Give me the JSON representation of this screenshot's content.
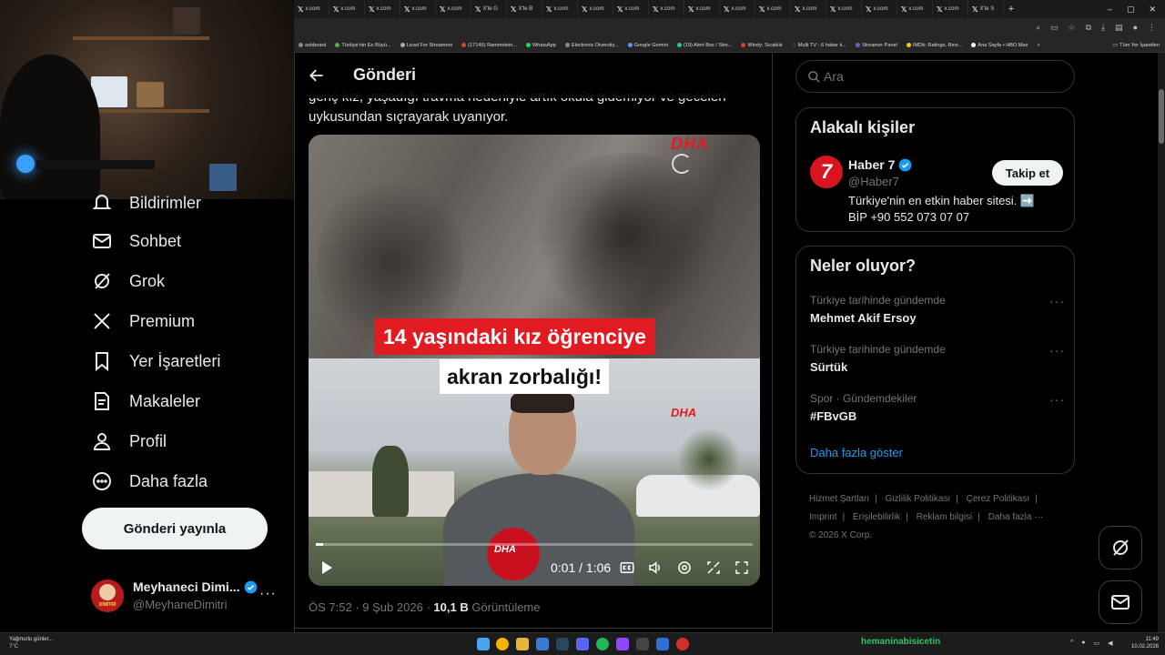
{
  "browser": {
    "tabs": [
      {
        "label": "x.com"
      },
      {
        "label": "x.com"
      },
      {
        "label": "x.com"
      },
      {
        "label": "x.com"
      },
      {
        "label": "x.com"
      },
      {
        "label": "X'te G"
      },
      {
        "label": "X'te B"
      },
      {
        "label": "x.com"
      },
      {
        "label": "x.com"
      },
      {
        "label": "x.com"
      },
      {
        "label": "x.com"
      },
      {
        "label": "x.com"
      },
      {
        "label": "x.com"
      },
      {
        "label": "x.com"
      },
      {
        "label": "x.com"
      },
      {
        "label": "x.com"
      },
      {
        "label": "x.com"
      },
      {
        "label": "x.com"
      },
      {
        "label": "x.com"
      },
      {
        "label": "X'te S"
      }
    ],
    "new_tab": "+",
    "window_controls": {
      "minimize": "–",
      "maximize": "▢",
      "close": "✕"
    },
    "bookmarks": [
      {
        "label": "ashboard",
        "color": "#888"
      },
      {
        "label": "Türkiye'nin En Büyü...",
        "color": "#4caf50"
      },
      {
        "label": "Livad For Streamers",
        "color": "#aaa"
      },
      {
        "label": "(17145) Rammstein...",
        "color": "#e53935"
      },
      {
        "label": "WhatsApp",
        "color": "#25d366"
      },
      {
        "label": "Electronic Diversity...",
        "color": "#888"
      },
      {
        "label": "Google Gemini",
        "color": "#6d8cff"
      },
      {
        "label": "(19) Alert Box / Stre...",
        "color": "#31c48d"
      },
      {
        "label": "Windy: Sıcaklık",
        "color": "#e53935"
      },
      {
        "label": "Multi TV - 6 haber k...",
        "color": "#333"
      },
      {
        "label": "Streamer Panel",
        "color": "#5c6bc0"
      },
      {
        "label": "IMDb: Ratings, Revi...",
        "color": "#f5c518"
      },
      {
        "label": "Ana Sayfa • HBO Max",
        "color": "#fff"
      }
    ],
    "bookmarks_more": "»",
    "all_bookmarks": "Tüm Yer İşaretleri"
  },
  "nav": {
    "items": [
      {
        "label": "Bildirimler"
      },
      {
        "label": "Sohbet"
      },
      {
        "label": "Grok"
      },
      {
        "label": "Premium"
      },
      {
        "label": "Yer İşaretleri"
      },
      {
        "label": "Makaleler"
      },
      {
        "label": "Profil"
      },
      {
        "label": "Daha fazla"
      }
    ],
    "post_button": "Gönderi yayınla",
    "account": {
      "name": "Meyhaneci Dimi...",
      "handle": "@MeyhaneDimitri",
      "avatar_text": "DİMİTRİ"
    }
  },
  "main": {
    "header_title": "Gönderi",
    "tweet_text": "genç kız, yaşadığı travma nedeniyle artık okula gidemiyor ve geceleri uykusundan sıçrayarak uyanıyor.",
    "video": {
      "caption_line1": "14 yaşındaki kız öğrenciye",
      "caption_line2": "akran zorbalığı!",
      "watermark": "DHA",
      "time": "0:01 / 1:06",
      "progress": 0.016
    },
    "meta": {
      "time": "ÖS 7:52",
      "date": "9 Şub 2026",
      "views_count": "10,1 B",
      "views_label": "Görüntüleme",
      "sep": "·"
    }
  },
  "right": {
    "search_placeholder": "Ara",
    "related": {
      "title": "Alakalı kişiler",
      "name": "Haber 7",
      "handle": "@Haber7",
      "avatar_text": "7",
      "bio": "Türkiye'nin en etkin haber sitesi. ➡️\nBİP +90 552 073 07 07",
      "follow": "Takip et"
    },
    "trends": {
      "title": "Neler oluyor?",
      "items": [
        {
          "context": "Türkiye tarihinde gündemde",
          "name": "Mehmet Akif Ersoy"
        },
        {
          "context": "Türkiye tarihinde gündemde",
          "name": "Sürtük"
        },
        {
          "context": "Spor · Gündemdekiler",
          "name": "#FBvGB"
        }
      ],
      "more_dots": "···",
      "show_more": "Daha fazla göster"
    },
    "footer": {
      "links": [
        "Hizmet Şartları",
        "Gizlilik Politikası",
        "Çerez Politikası",
        "Imprint",
        "Erişilebilirlik",
        "Reklam bilgisi",
        "Daha fazla ···"
      ],
      "sep": "|",
      "copyright": "© 2026 X Corp."
    }
  },
  "taskbar": {
    "weather_text": "Yağmurlu günler...",
    "weather_temp": "7°C",
    "streamer_name": "hemaninabisicetin",
    "clock_time": "11:49",
    "clock_date": "10.02.2026"
  },
  "colors": {
    "accent": "#1d9bf0",
    "red": "#e11b22",
    "verified": "#1d9bf0"
  }
}
